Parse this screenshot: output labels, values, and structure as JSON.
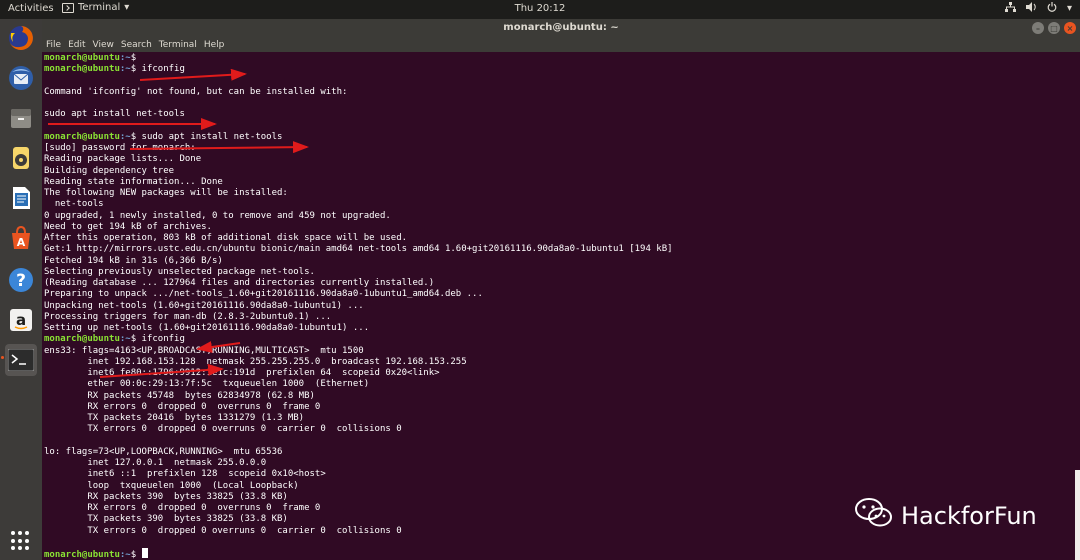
{
  "topbar": {
    "activities": "Activities",
    "app_name": "Terminal",
    "clock": "Thu 20:12",
    "tray_icons": [
      "network-icon",
      "volume-icon",
      "power-icon"
    ]
  },
  "dock": {
    "items": [
      "firefox-icon",
      "thunderbird-icon",
      "files-icon",
      "rhythmbox-icon",
      "libreoffice-writer-icon",
      "software-center-icon",
      "help-icon",
      "amazon-icon",
      "terminal-icon"
    ],
    "active": "terminal-icon",
    "show_apps": "show-applications-icon"
  },
  "window": {
    "title": "monarch@ubuntu: ~",
    "menus": [
      "File",
      "Edit",
      "View",
      "Search",
      "Terminal",
      "Help"
    ]
  },
  "prompt": {
    "user": "monarch@ubuntu",
    "path": ":~",
    "symbol": "$"
  },
  "terminal": {
    "lines": [
      {
        "prompt": true,
        "cmd": ""
      },
      {
        "prompt": true,
        "cmd": "ifconfig"
      },
      {
        "text": ""
      },
      {
        "text": "Command 'ifconfig' not found, but can be installed with:"
      },
      {
        "text": ""
      },
      {
        "text": "sudo apt install net-tools"
      },
      {
        "text": ""
      },
      {
        "prompt": true,
        "cmd": "sudo apt install net-tools"
      },
      {
        "text": "[sudo] password for monarch:"
      },
      {
        "text": "Reading package lists... Done"
      },
      {
        "text": "Building dependency tree"
      },
      {
        "text": "Reading state information... Done"
      },
      {
        "text": "The following NEW packages will be installed:"
      },
      {
        "text": "  net-tools"
      },
      {
        "text": "0 upgraded, 1 newly installed, 0 to remove and 459 not upgraded."
      },
      {
        "text": "Need to get 194 kB of archives."
      },
      {
        "text": "After this operation, 803 kB of additional disk space will be used."
      },
      {
        "text": "Get:1 http://mirrors.ustc.edu.cn/ubuntu bionic/main amd64 net-tools amd64 1.60+git20161116.90da8a0-1ubuntu1 [194 kB]"
      },
      {
        "text": "Fetched 194 kB in 31s (6,366 B/s)"
      },
      {
        "text": "Selecting previously unselected package net-tools."
      },
      {
        "text": "(Reading database ... 127964 files and directories currently installed.)"
      },
      {
        "text": "Preparing to unpack .../net-tools_1.60+git20161116.90da8a0-1ubuntu1_amd64.deb ..."
      },
      {
        "text": "Unpacking net-tools (1.60+git20161116.90da8a0-1ubuntu1) ..."
      },
      {
        "text": "Processing triggers for man-db (2.8.3-2ubuntu0.1) ..."
      },
      {
        "text": "Setting up net-tools (1.60+git20161116.90da8a0-1ubuntu1) ..."
      },
      {
        "prompt": true,
        "cmd": "ifconfig"
      },
      {
        "text": "ens33: flags=4163<UP,BROADCAST,RUNNING,MULTICAST>  mtu 1500"
      },
      {
        "text": "        inet 192.168.153.128  netmask 255.255.255.0  broadcast 192.168.153.255"
      },
      {
        "text": "        inet6 fe80::1796:9912:1e1c:191d  prefixlen 64  scopeid 0x20<link>"
      },
      {
        "text": "        ether 00:0c:29:13:7f:5c  txqueuelen 1000  (Ethernet)"
      },
      {
        "text": "        RX packets 45748  bytes 62834978 (62.8 MB)"
      },
      {
        "text": "        RX errors 0  dropped 0  overruns 0  frame 0"
      },
      {
        "text": "        TX packets 20416  bytes 1331279 (1.3 MB)"
      },
      {
        "text": "        TX errors 0  dropped 0 overruns 0  carrier 0  collisions 0"
      },
      {
        "text": ""
      },
      {
        "text": "lo: flags=73<UP,LOOPBACK,RUNNING>  mtu 65536"
      },
      {
        "text": "        inet 127.0.0.1  netmask 255.0.0.0"
      },
      {
        "text": "        inet6 ::1  prefixlen 128  scopeid 0x10<host>"
      },
      {
        "text": "        loop  txqueuelen 1000  (Local Loopback)"
      },
      {
        "text": "        RX packets 390  bytes 33825 (33.8 KB)"
      },
      {
        "text": "        RX errors 0  dropped 0  overruns 0  frame 0"
      },
      {
        "text": "        TX packets 390  bytes 33825 (33.8 KB)"
      },
      {
        "text": "        TX errors 0  dropped 0 overruns 0  carrier 0  collisions 0"
      },
      {
        "text": ""
      },
      {
        "prompt": true,
        "cmd": "",
        "cursor": true
      }
    ]
  },
  "watermark": {
    "text": "HackforFun",
    "icon": "wechat-icon"
  },
  "colors": {
    "terminal_bg": "#300a24",
    "prompt_user": "#8ae234",
    "prompt_path": "#729fcf",
    "annotation_arrow": "#e01b1b",
    "accent": "#e95420"
  }
}
